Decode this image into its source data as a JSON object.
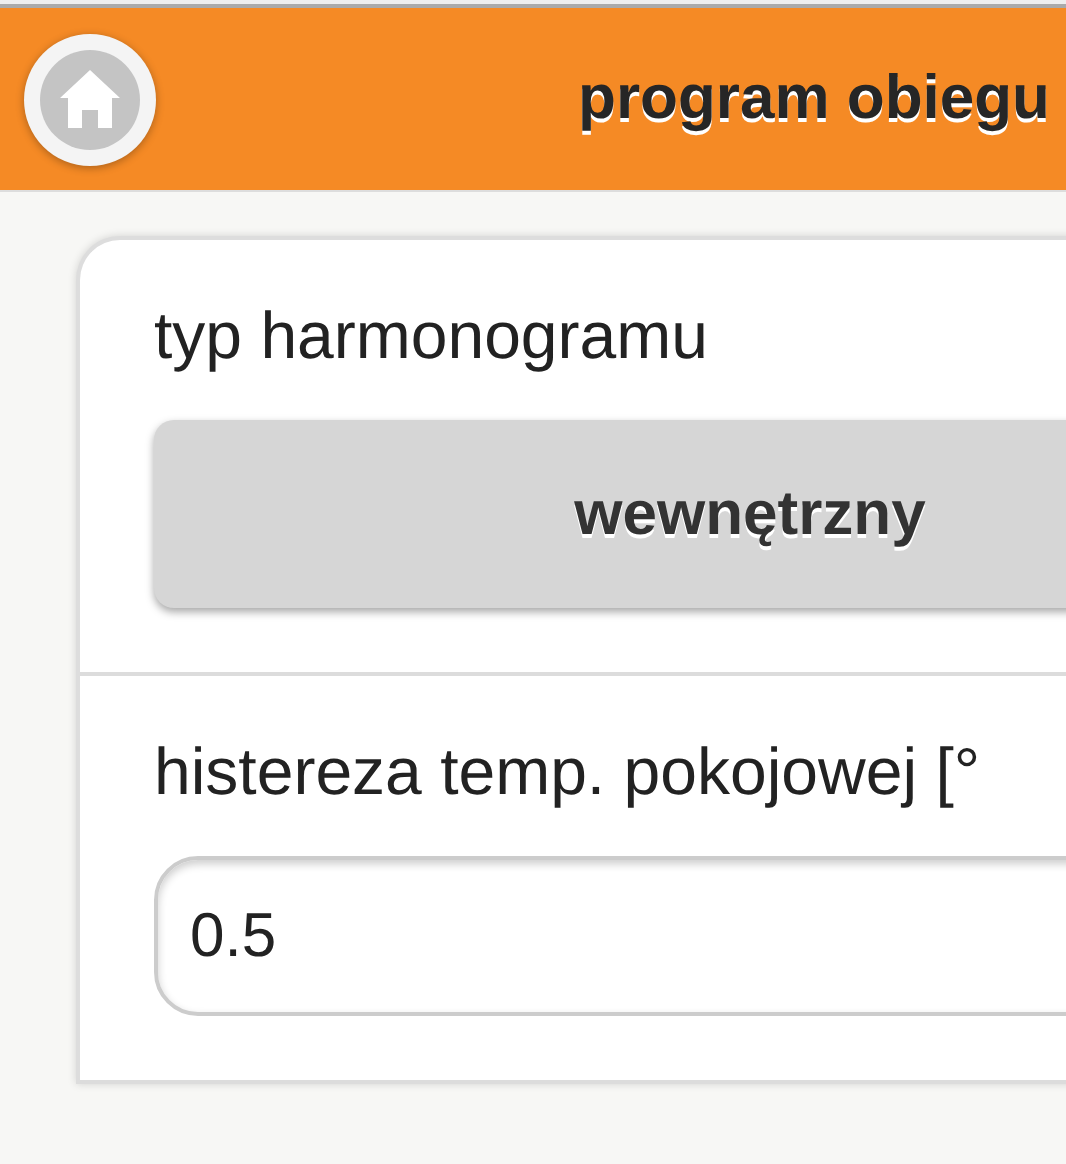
{
  "header": {
    "title": "program obiegu"
  },
  "settings": [
    {
      "kind": "select",
      "label": "typ harmonogramu",
      "value": "wewnętrzny"
    },
    {
      "kind": "input",
      "label": "histereza temp. pokojowej [°",
      "value": "0.5"
    }
  ]
}
